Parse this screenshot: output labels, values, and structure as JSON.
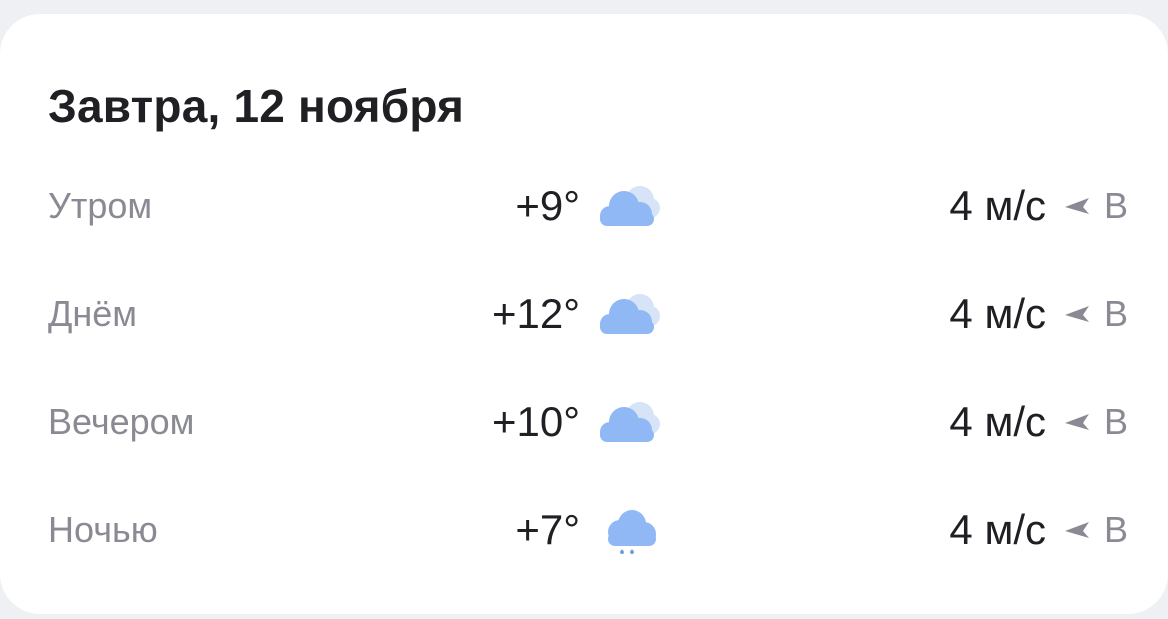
{
  "card": {
    "title": "Завтра, 12 ноября"
  },
  "rows": [
    {
      "period": "Утром",
      "temperature": "+9°",
      "condition_icon": "cloudy-icon",
      "wind_speed": "4 м/с",
      "wind_direction_icon": "wind-arrow-icon",
      "wind_direction": "В"
    },
    {
      "period": "Днём",
      "temperature": "+12°",
      "condition_icon": "cloudy-icon",
      "wind_speed": "4 м/с",
      "wind_direction_icon": "wind-arrow-icon",
      "wind_direction": "В"
    },
    {
      "period": "Вечером",
      "temperature": "+10°",
      "condition_icon": "cloudy-icon",
      "wind_speed": "4 м/с",
      "wind_direction_icon": "wind-arrow-icon",
      "wind_direction": "В"
    },
    {
      "period": "Ночью",
      "temperature": "+7°",
      "condition_icon": "rain-cloud-icon",
      "wind_speed": "4 м/с",
      "wind_direction_icon": "wind-arrow-icon",
      "wind_direction": "В"
    }
  ],
  "colors": {
    "background": "#eef0f4",
    "card": "#ffffff",
    "primary_text": "#1f1f24",
    "secondary_text": "#8a8a94",
    "cloud_front": "#8fb8f4",
    "cloud_back": "#d7e3f7",
    "rain_drop": "#6b9edc",
    "arrow": "#8a8a94"
  }
}
